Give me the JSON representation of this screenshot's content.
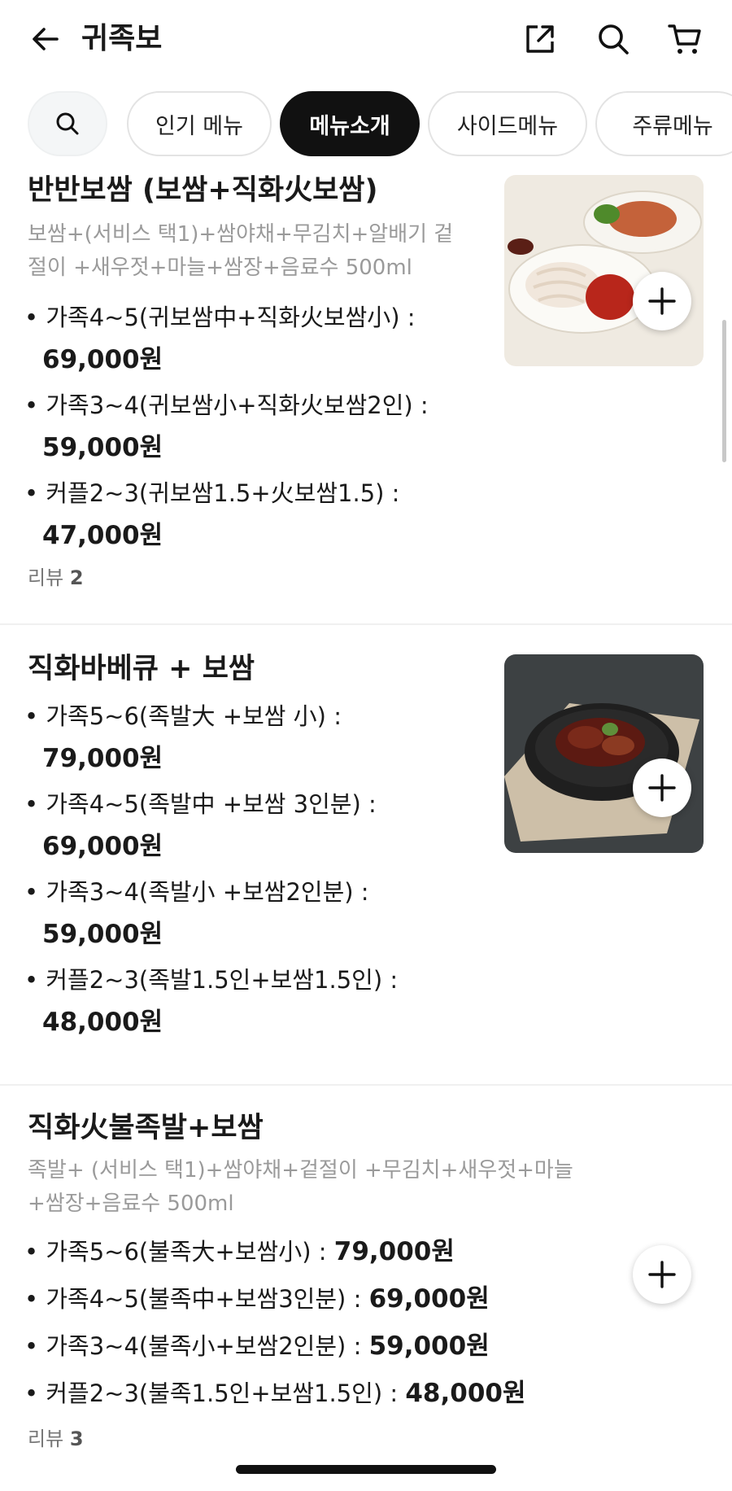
{
  "header": {
    "title": "귀족보",
    "icons": [
      "arrow-left-icon",
      "share-icon",
      "search-icon",
      "cart-icon"
    ]
  },
  "chips": [
    {
      "label": "인기 메뉴"
    },
    {
      "label": "메뉴소개"
    },
    {
      "label": "사이드메뉴"
    },
    {
      "label": "주류메뉴"
    }
  ],
  "active_chip": "메뉴소개",
  "sections": [
    {
      "title": "반반보쌈 (보쌈+직화火보쌈)",
      "desc_lines": [
        "보쌈+(서비스  택1)+쌈야채+무김치+알배기 겉",
        "절이 +새우젓+마늘+쌈장+음료수 500ml"
      ],
      "options": [
        {
          "label": "가족4~5(귀보쌈中+직화火보쌈小) :",
          "price": "69,000원"
        },
        {
          "label": "가족3~4(귀보쌈小+직화火보쌈2인) :",
          "price": "59,000원"
        },
        {
          "label": "커플2~3(귀보쌈1.5+火보쌈1.5) :",
          "price": "47,000원"
        }
      ],
      "review_label": "리뷰",
      "review_count": "2"
    },
    {
      "title": "직화바베큐 + 보쌈",
      "options": [
        {
          "label": "가족5~6(족발大 +보쌈 小) :",
          "price": "79,000원"
        },
        {
          "label": "가족4~5(족발中 +보쌈 3인분) :",
          "price": "69,000원"
        },
        {
          "label": "가족3~4(족발小 +보쌈2인분) :",
          "price": "59,000원"
        },
        {
          "label": "커플2~3(족발1.5인+보쌈1.5인) :",
          "price": "48,000원"
        }
      ]
    },
    {
      "title": "직화火불족발+보쌈",
      "desc_lines": [
        "족발+ (서비스 택1)+쌈야채+겉절이 +무김치+새우젓+마늘",
        "+쌈장+음료수 500ml"
      ],
      "options": [
        {
          "label": "가족5~6(불족大+보쌈小) :",
          "price": "79,000원"
        },
        {
          "label": "가족4~5(불족中+보쌈3인분) :",
          "price": "69,000원"
        },
        {
          "label": "가족3~4(불족小+보쌈2인분) :",
          "price": "59,000원"
        },
        {
          "label": "커플2~3(불족1.5인+보쌈1.5인) :",
          "price": "48,000원"
        }
      ],
      "review_label": "리뷰",
      "review_count": "3"
    }
  ],
  "colors": {
    "active_chip_bg": "#111111",
    "desc_text": "#9a9a9a",
    "divider": "#f0f0f0"
  }
}
